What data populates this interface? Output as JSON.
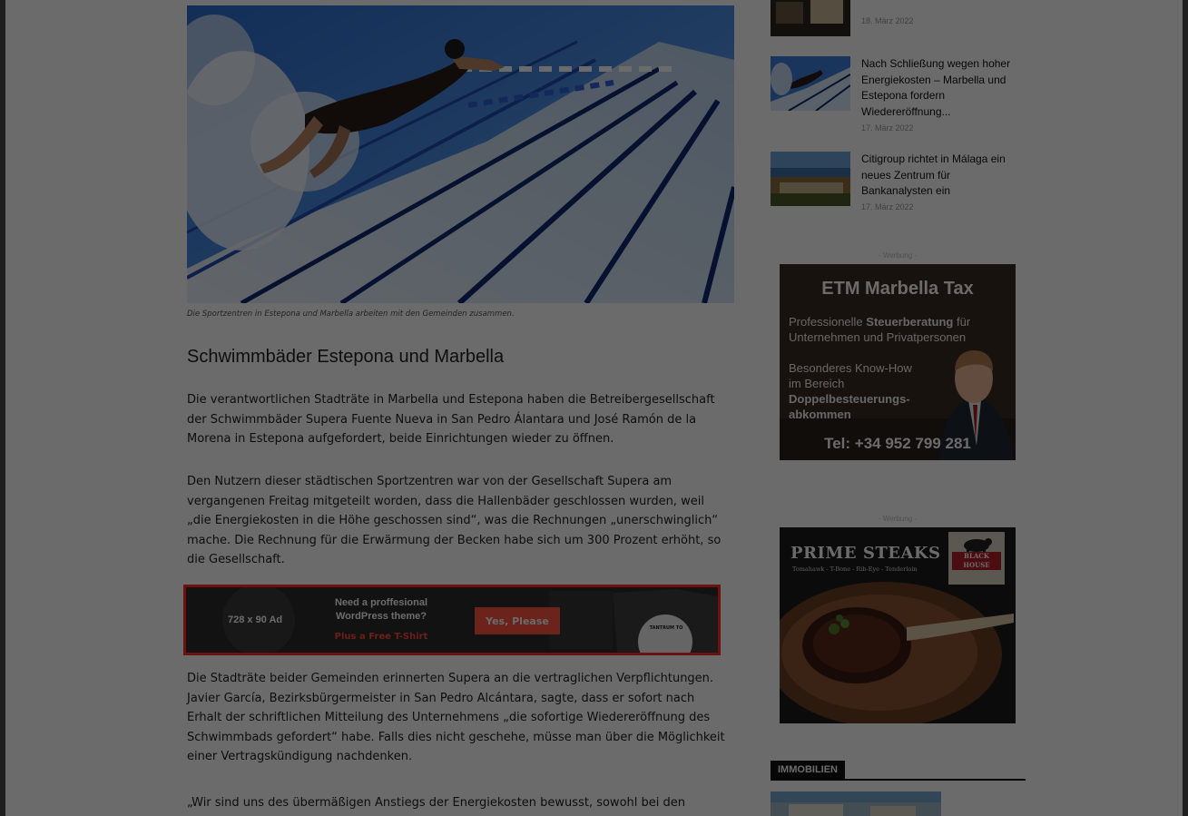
{
  "article": {
    "caption": "Die Sportzentren in Estepona und Marbella arbeiten mit den Gemeinden zusammen.",
    "heading": "Schwimmbäder Estepona und Marbella",
    "paragraphs": [
      "Die verantwortlichen Stadträte in Marbella und Estepona haben die Betreibergesellschaft der Schwimmbäder Supera Fuente Nueva in San Pedro Álantara und José Ramón de la Morena in Estepona  aufgefordert, beide Einrichtungen wieder zu öffnen.",
      "Den Nutzern dieser städtischen Sportzentren war von der Gesellschaft Supera am vergangenen Freitag mitgeteilt worden, dass die Hallenbäder geschlossen wurden, weil „die Energiekosten in die Höhe geschossen sind“, was die Rechnungen „unerschwinglich“ mache. Die Rechnung für die Erwärmung der Becken habe sich um 300 Prozent erhöht, so die Gesellschaft.",
      "Die Stadträte beider Gemeinden erinnerten Supera an die vertraglichen Verpflichtungen. Javier García, Bezirksbürgermeister in San Pedro Alcántara, sagte, dass er sofort nach Erhalt der schriftlichen Mitteilung des Unternehmens „die sofortige Wiedereröffnung des Schwimmbads gefordert“ habe. Falls dies nicht geschehe, müsse man über die Möglichkeit einer Vertragskündigung nachdenken.",
      "„Wir sind uns des übermäßigen Anstiegs der Energiekosten bewusst, sowohl bei den"
    ]
  },
  "banner_ad": {
    "size_label": "728 x 90 Ad",
    "headline_1": "Need a proffesional",
    "headline_2": "WordPress theme?",
    "tagline": "Plus a Free T-Shirt",
    "button": "Yes, Please",
    "badge": "TANTRUM TO"
  },
  "sidebar": {
    "news": [
      {
        "title": "",
        "date": "18. März 2022"
      },
      {
        "title": "Nach Schließung wegen hoher Energiekosten – Marbella und Estepona fordern Wiedereröffnung...",
        "date": "17. März 2022"
      },
      {
        "title": "Citigroup richtet in Málaga ein neues Zentrum für Bankanalysten ein",
        "date": "17. März 2022"
      }
    ],
    "werbung_label": "- Werbung -",
    "etm_ad": {
      "title": "ETM Marbella Tax",
      "line1_a": "Professionelle ",
      "line1_b": "Steuerberatung",
      "line1_c": " für",
      "line2": "Unternehmen und Privatpersonen",
      "know1": "Besonderes Know-How",
      "know2": "im Bereich",
      "know3": "Doppelbesteuerungs-",
      "know4": "abkommen",
      "tel": "Tel: +34 952 799 281"
    },
    "prime_ad": {
      "title": "PRIME STEAKS",
      "subtitle": "Tomahawk - T-Bone - Rib-Eye - Tenderloin",
      "logo_text": "BLACK HOUSE"
    },
    "section_label": "IMMOBILIEN"
  }
}
